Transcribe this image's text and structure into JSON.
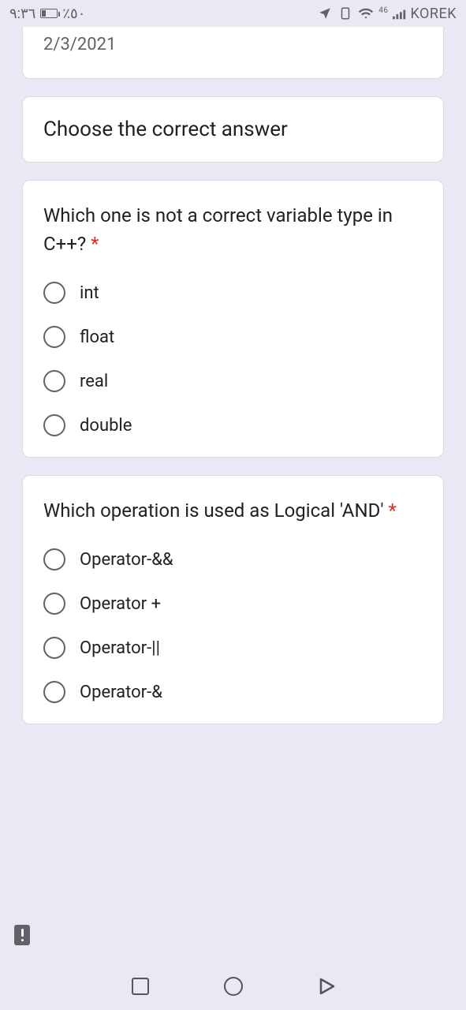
{
  "statusbar": {
    "time": "٩:٣٦",
    "battery_pct": "٪٥٠",
    "carrier": "KOREK",
    "network_badge": "46"
  },
  "form": {
    "date": "2/3/2021",
    "section_title": "Choose the correct answer"
  },
  "questions": [
    {
      "text": "Which one is not a correct variable type in C++?",
      "required": "*",
      "options": [
        "int",
        "float",
        "real",
        "double"
      ]
    },
    {
      "text": "Which operation is used as Logical 'AND'",
      "required": "*",
      "options": [
        "Operator-&&",
        "Operator +",
        "Operator-||",
        "Operator-&"
      ]
    }
  ]
}
